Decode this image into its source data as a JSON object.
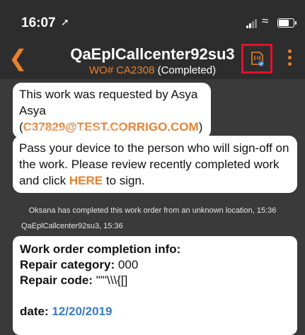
{
  "status_bar": {
    "time": "16:07",
    "location_icon": "location-arrow-icon",
    "signal_icon": "cellular-signal-icon",
    "wifi_icon": "wifi-icon",
    "battery_icon": "battery-icon"
  },
  "header": {
    "back_icon": "chevron-left-icon",
    "title": "QaEplCallcenter92su3",
    "wo_prefix": "WO# CA2308",
    "status": "(Completed)",
    "sign_icon": "document-signature-icon",
    "more_icon": "vertical-ellipsis-icon",
    "accent_color": "#e9822e",
    "highlight_color": "#e4102a"
  },
  "messages": {
    "m1_text": "This work was requested by Asya Asya",
    "m1_open": "(",
    "m1_email": "C37829@TEST.CORRIGO.COM",
    "m1_close": ")",
    "m2_meta": "QaEplCallcenter92su3, 15:36",
    "m2_text_before": "Pass your device to the person who will sign-off on the work. Please review recently completed work and click",
    "m2_here": "HERE",
    "m2_text_after": "to sign.",
    "system_note": "Oksana has completed this work order from an unknown location, 15:36",
    "m3_meta": "QaEplCallcenter92su3, 15:36",
    "m3_heading": "Work order completion info:",
    "m3_repair_category_label": "Repair category:",
    "m3_repair_category_value": "000",
    "m3_repair_code_label": "Repair code:",
    "m3_repair_code_value": "\"\"'\\\\\\{[]",
    "m3_date_label": "date:",
    "m3_date_value": "12/20/2019"
  }
}
